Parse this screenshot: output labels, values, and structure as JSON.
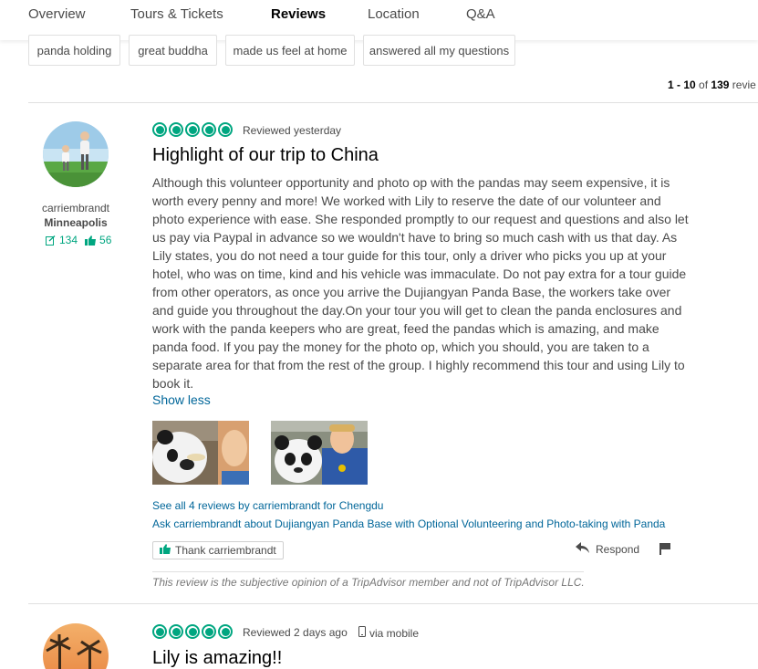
{
  "tabs": [
    {
      "label": "Overview",
      "active": false
    },
    {
      "label": "Tours & Tickets",
      "active": false
    },
    {
      "label": "Reviews",
      "active": true
    },
    {
      "label": "Location",
      "active": false
    },
    {
      "label": "Q&A",
      "active": false
    }
  ],
  "keyword_chips": [
    "panda holding",
    "great buddha",
    "made us feel at home",
    "answered all my questions"
  ],
  "pagination": {
    "start": "1",
    "sep": " - ",
    "end": "10",
    "of_text": " of ",
    "total": "139",
    "suffix": " revie"
  },
  "accent_color": "#00a680",
  "link_color": "#006699",
  "reviews": [
    {
      "member": {
        "username": "carriembrandt",
        "location": "Minneapolis",
        "contributions": "134",
        "helpful_votes": "56",
        "contributions_icon": "review-count-icon",
        "votes_icon": "thumbs-up-icon"
      },
      "rating_bubbles": 5,
      "date": "Reviewed yesterday",
      "title": "Highlight of our trip to China",
      "body": "Although this volunteer opportunity and photo op with the pandas may seem expensive, it is worth every penny and more! We worked with Lily to reserve the date of our volunteer and photo experience with ease. She responded promptly to our request and questions and also let us pay via Paypal in advance so we wouldn't have to bring so much cash with us that day. As Lily states, you do not need a tour guide for this tour, only a driver who picks you up at your hotel, who was on time, kind and his vehicle was immaculate. Do not pay extra for a tour guide from other operators, as once you arrive the Dujiangyan Panda Base, the workers take over and guide you throughout the day.On your tour you will get to clean the panda enclosures and work with the panda keepers who are great, feed the pandas which is amazing, and make panda food. If you pay the money for the photo op, which you should, you are taken to a separate area for that from the rest of the group. I highly recommend this tour and using Lily to book it.",
      "show_less": "Show less",
      "see_all_link": "See all 4 reviews by carriembrandt for Chengdu",
      "ask_link": "Ask carriembrandt about Dujiangyan Panda Base with Optional Volunteering and Photo-taking with Panda",
      "thank_button": "Thank carriembrandt",
      "respond": "Respond",
      "disclaimer": "This review is the subjective opinion of a TripAdvisor member and not of TripAdvisor LLC."
    },
    {
      "rating_bubbles": 5,
      "date": "Reviewed 2 days ago",
      "via": "via mobile",
      "title": "Lily is amazing!!"
    }
  ]
}
